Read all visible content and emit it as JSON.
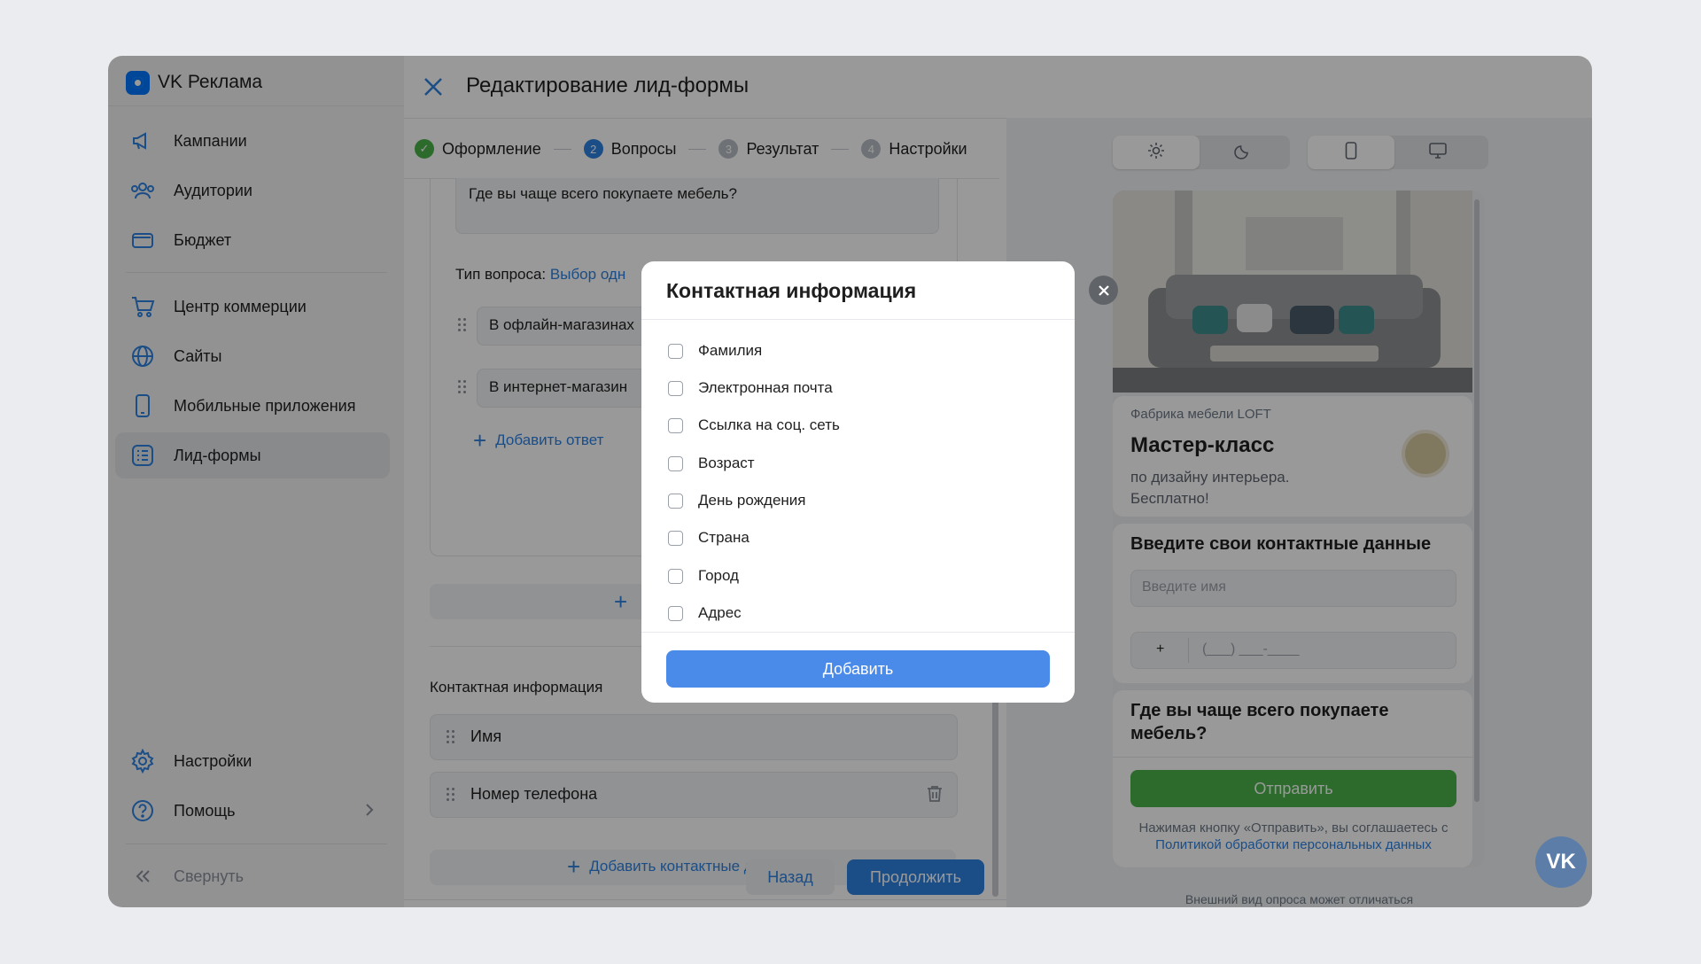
{
  "app": {
    "name": "VK Реклама"
  },
  "sidebar": {
    "items": [
      {
        "label": "Кампании",
        "icon": "megaphone-icon"
      },
      {
        "label": "Аудитории",
        "icon": "users-icon"
      },
      {
        "label": "Бюджет",
        "icon": "wallet-icon"
      },
      {
        "label": "Центр коммерции",
        "icon": "cart-icon"
      },
      {
        "label": "Сайты",
        "icon": "globe-icon"
      },
      {
        "label": "Мобильные приложения",
        "icon": "phone-icon"
      },
      {
        "label": "Лид-формы",
        "icon": "list-icon",
        "active": true
      }
    ],
    "bottom": [
      {
        "label": "Настройки",
        "icon": "gear-icon"
      },
      {
        "label": "Помощь",
        "icon": "help-icon"
      }
    ],
    "collapse": "Свернуть"
  },
  "header": {
    "title": "Редактирование лид-формы"
  },
  "steps": [
    {
      "num": "✓",
      "label": "Оформление",
      "state": "done"
    },
    {
      "num": "2",
      "label": "Вопросы",
      "state": "current"
    },
    {
      "num": "3",
      "label": "Результат",
      "state": "pending"
    },
    {
      "num": "4",
      "label": "Настройки",
      "state": "pending"
    }
  ],
  "editor": {
    "question_text": "Где вы чаще всего покупаете мебель?",
    "question_type_label": "Тип вопроса:",
    "question_type_value": "Выбор одн",
    "answers": [
      "В офлайн-магазинах",
      "В интернет-магазин"
    ],
    "add_answer": "Добавить ответ",
    "contact_title": "Контактная информация",
    "contact_fields": [
      "Имя",
      "Номер телефона"
    ],
    "add_contact": "Добавить контактные данные",
    "back": "Назад",
    "continue": "Продолжить"
  },
  "preview": {
    "company": "Фабрика мебели LOFT",
    "headline": "Мастер-класс",
    "subtitle_line1": "по дизайну интерьера.",
    "subtitle_line2": "Бесплатно!",
    "contact_heading": "Введите свои контактные данные",
    "name_placeholder": "Введите имя",
    "phone_prefix": "+",
    "phone_mask": "(___) ___-____",
    "question": "Где вы чаще всего покупаете мебель?",
    "send": "Отправить",
    "legal_text": "Нажимая кнопку «Отправить», вы соглашаетесь с",
    "legal_link": "Политикой обработки персональных данных",
    "note": "Внешний вид опроса может отличаться"
  },
  "modal": {
    "title": "Контактная информация",
    "options": [
      "Фамилия",
      "Электронная почта",
      "Ссылка на соц. сеть",
      "Возраст",
      "День рождения",
      "Страна",
      "Город",
      "Адрес"
    ],
    "add": "Добавить"
  },
  "colors": {
    "accent": "#2d81e0",
    "send_green": "#4bb34b",
    "modal_button": "#4a8ae8"
  }
}
